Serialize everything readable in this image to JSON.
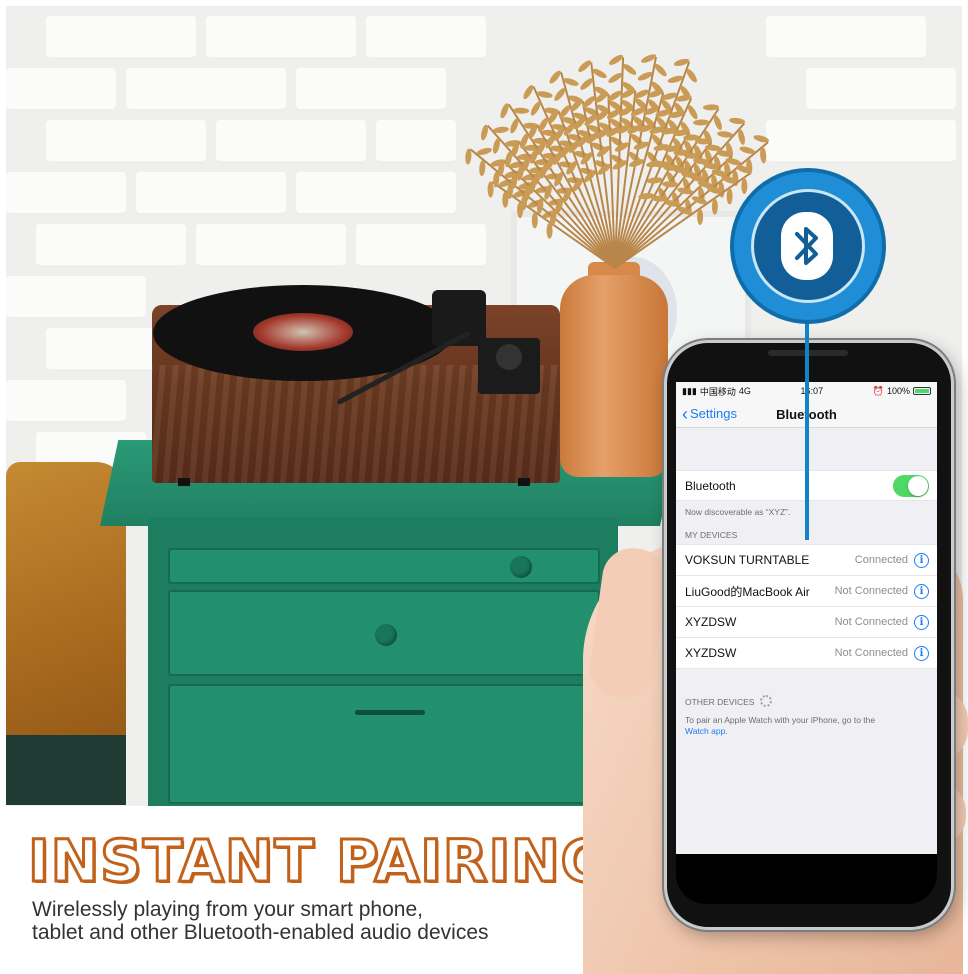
{
  "phone": {
    "status_bar": {
      "carrier": "中国移动",
      "network": "4G",
      "time": "16:07",
      "battery": "100%"
    },
    "nav": {
      "back_label": "Settings",
      "title": "Bluetooth"
    },
    "bluetooth_toggle": {
      "label": "Bluetooth",
      "state": "on"
    },
    "discoverable_text": "Now discoverable as “XYZ”.",
    "my_devices_header": "MY DEVICES",
    "devices": [
      {
        "name": "VOKSUN TURNTABLE",
        "status": "Connected"
      },
      {
        "name": "LiuGood的MacBook Air",
        "status": "Not Connected"
      },
      {
        "name": "XYZDSW",
        "status": "Not Connected"
      },
      {
        "name": "XYZDSW",
        "status": "Not Connected"
      }
    ],
    "other_devices_header": "OTHER DEVICES",
    "watch_hint": "To pair an Apple Watch with your iPhone, go to the",
    "watch_link": "Watch app."
  },
  "caption": {
    "title": "INSTANT PAIRING",
    "line1": "Wirelessly playing from your smart phone,",
    "line2": "tablet and other Bluetooth-enabled audio devices"
  },
  "colors": {
    "accent_blue": "#1b7cf5",
    "toggle_green": "#4cd964",
    "title_orange": "#c2611a",
    "bluetooth_badge": "#1f8ed6"
  },
  "icons": {
    "bluetooth_badge": "bluetooth-icon",
    "back": "chevron-left-icon",
    "info": "info-icon",
    "loading": "spinner-icon"
  }
}
